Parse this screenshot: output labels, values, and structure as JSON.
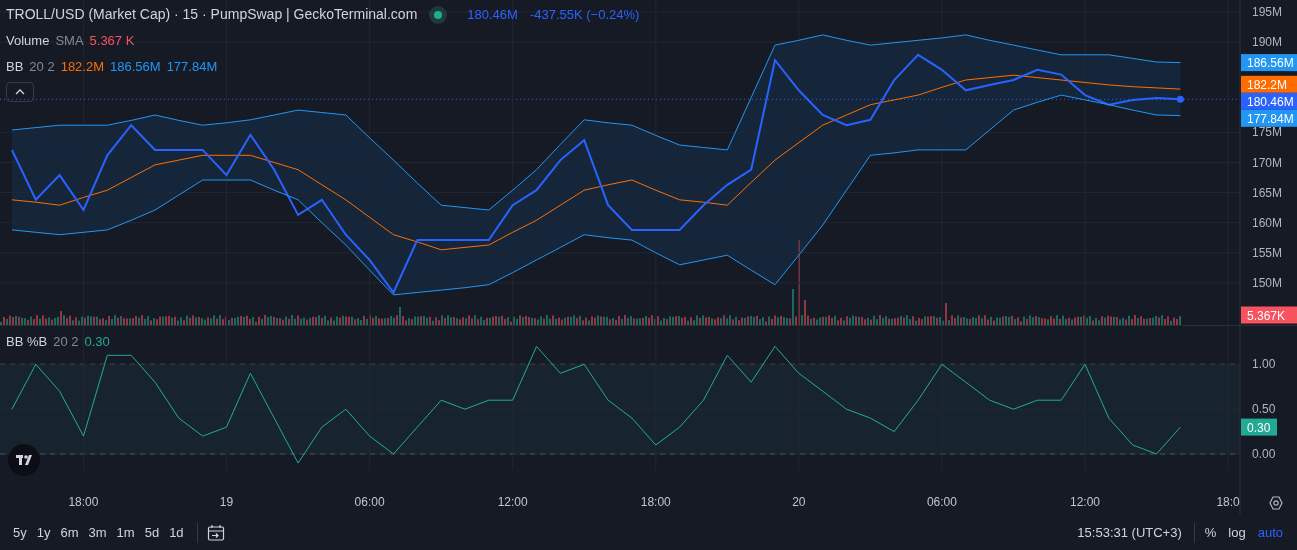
{
  "main_chart": {
    "title": "TROLL/USD (Market Cap) · 15 · PumpSwap | GeckoTerminal.com",
    "last": "180.46M",
    "change": "-437.55K (−0.24%)",
    "indicators": [
      {
        "name": "Volume",
        "params": "SMA",
        "values": [
          {
            "text": "5.367 K",
            "color": "#f7525f"
          }
        ]
      },
      {
        "name": "BB",
        "params": "20 2",
        "values": [
          {
            "text": "182.2M",
            "color": "#ff6d00"
          },
          {
            "text": "186.56M",
            "color": "#2196f3"
          },
          {
            "text": "177.84M",
            "color": "#2196f3"
          }
        ]
      }
    ],
    "price_labels": [
      {
        "kind": "series",
        "text": "186.56M",
        "color": "#2196f3"
      },
      {
        "kind": "series",
        "text": "182.2M",
        "color": "#ff6d00"
      },
      {
        "kind": "series",
        "text": "180.46M",
        "color": "#2962ff"
      },
      {
        "kind": "series",
        "text": "177.84M",
        "color": "#2196f3"
      },
      {
        "kind": "volume",
        "text": "5.367K",
        "color": "#f7525f"
      }
    ],
    "chart_data": {
      "type": "line",
      "grid": true,
      "categories": [
        null,
        null,
        null,
        null,
        null,
        null,
        null,
        null,
        null,
        null,
        null,
        null,
        null,
        null,
        null,
        null,
        null,
        null,
        null,
        null,
        null,
        null,
        null,
        null,
        null,
        null,
        null,
        null,
        null,
        null,
        null,
        null,
        null,
        null,
        null,
        null,
        null,
        null,
        null,
        null,
        null,
        null,
        null,
        null,
        null,
        null,
        null,
        null,
        null,
        null
      ],
      "ylim": [
        143,
        197
      ],
      "yticks": [
        {
          "value": 150,
          "label": "150M"
        },
        {
          "value": 155,
          "label": "155M"
        },
        {
          "value": 160,
          "label": "160M"
        },
        {
          "value": 165,
          "label": "165M"
        },
        {
          "value": 170,
          "label": "170M"
        },
        {
          "value": 175,
          "label": "175M"
        },
        {
          "value": 190,
          "label": "190M"
        },
        {
          "value": 195,
          "label": "195M"
        }
      ],
      "series": [
        {
          "color": "#2196f3",
          "values": [
            175.4,
            175.8,
            176.2,
            176.2,
            176.2,
            177.0,
            177.9,
            177.0,
            176.2,
            176.6,
            177.1,
            177.9,
            178.7,
            178.3,
            177.9,
            174.1,
            170.4,
            166.6,
            162.9,
            162.5,
            162.1,
            165.4,
            168.8,
            173.0,
            177.1,
            176.6,
            176.2,
            174.5,
            172.9,
            172.5,
            172.1,
            180.8,
            189.5,
            190.3,
            191.2,
            190.3,
            189.5,
            189.9,
            190.3,
            190.7,
            191.2,
            190.3,
            189.5,
            188.7,
            187.9,
            187.9,
            187.9,
            187.3,
            186.7,
            186.6
          ]
        },
        {
          "color": "#ff6d00",
          "values": [
            163.8,
            163.4,
            162.9,
            164.2,
            165.4,
            167.5,
            169.6,
            170.4,
            171.2,
            171.2,
            171.2,
            170.0,
            168.8,
            166.3,
            163.8,
            160.9,
            158.0,
            156.8,
            155.5,
            155.9,
            156.3,
            158.4,
            160.4,
            162.9,
            165.4,
            166.3,
            167.1,
            165.4,
            163.8,
            163.4,
            162.9,
            166.7,
            170.4,
            173.3,
            176.2,
            177.9,
            179.6,
            180.4,
            181.2,
            182.5,
            183.7,
            184.1,
            184.5,
            184.1,
            183.7,
            183.3,
            182.9,
            182.6,
            182.4,
            182.2
          ]
        },
        {
          "color": "#2962ff",
          "values": [
            172.1,
            163.8,
            167.9,
            162.1,
            171.2,
            176.2,
            172.1,
            172.1,
            172.1,
            167.9,
            174.6,
            168.8,
            161.3,
            163.8,
            158.0,
            153.8,
            148.4,
            157.1,
            157.1,
            157.1,
            157.1,
            162.9,
            165.4,
            170.4,
            173.7,
            162.9,
            158.8,
            158.8,
            158.8,
            162.9,
            166.3,
            168.8,
            187.0,
            182.0,
            177.9,
            176.2,
            177.1,
            183.7,
            187.9,
            185.4,
            182.0,
            182.9,
            183.7,
            185.4,
            184.6,
            181.2,
            179.6,
            180.4,
            180.7,
            180.5
          ]
        },
        {
          "color": "#2196f3",
          "values": [
            158.8,
            158.4,
            158.0,
            158.4,
            158.8,
            160.4,
            162.1,
            164.6,
            167.1,
            167.1,
            167.1,
            165.4,
            163.8,
            160.0,
            156.3,
            152.1,
            148.0,
            148.4,
            148.8,
            149.2,
            149.7,
            151.7,
            153.8,
            155.9,
            158.0,
            157.5,
            157.1,
            155.0,
            153.0,
            153.8,
            154.6,
            152.1,
            149.7,
            154.6,
            159.6,
            165.4,
            171.2,
            171.6,
            172.1,
            172.1,
            172.1,
            175.4,
            178.7,
            180.0,
            181.2,
            180.4,
            179.6,
            178.7,
            177.9,
            177.8
          ]
        }
      ]
    },
    "time_axis_end_label": "18:0"
  },
  "oscillator": {
    "name": "BB %B",
    "params": "20 2",
    "value": {
      "text": "0.30",
      "color": "#22ab94"
    },
    "price_label": {
      "text": "0.30",
      "color": "#22ab94"
    },
    "chart_data": {
      "type": "line",
      "grid": true,
      "ylim": [
        -0.68,
        1.427
      ],
      "yticks": [
        {
          "value": 0,
          "label": "0.00"
        },
        {
          "value": 0.5,
          "label": "0.50"
        },
        {
          "value": 1,
          "label": "1.00"
        }
      ],
      "categories": [
        null,
        null,
        null,
        "18:00",
        null,
        null,
        null,
        null,
        null,
        "19",
        null,
        null,
        null,
        null,
        null,
        "06:00",
        null,
        null,
        null,
        null,
        null,
        "12:00",
        null,
        null,
        null,
        null,
        null,
        "18:00",
        null,
        null,
        null,
        null,
        null,
        "20",
        null,
        null,
        null,
        null,
        null,
        "06:00",
        null,
        null,
        null,
        null,
        null,
        "12:00",
        null,
        null,
        null,
        null
      ],
      "series": [
        {
          "color": "#22ab94",
          "values": [
            0.5,
            1.0,
            0.7,
            0.2,
            1.1,
            1.1,
            0.8,
            0.4,
            0.2,
            0.3,
            0.9,
            0.4,
            -0.1,
            0.3,
            0.5,
            0.2,
            0.0,
            0.3,
            0.6,
            0.5,
            0.6,
            0.6,
            1.2,
            0.9,
            1.0,
            0.6,
            0.4,
            0.1,
            0.3,
            0.6,
            1.1,
            0.8,
            1.2,
            0.9,
            0.7,
            0.5,
            0.4,
            0.25,
            0.6,
            1.0,
            0.8,
            0.6,
            0.5,
            0.6,
            0.6,
            1.0,
            0.4,
            0.1,
            0.0,
            0.3
          ]
        }
      ]
    }
  },
  "toolbar": {
    "ranges": [
      "5y",
      "1y",
      "6m",
      "3m",
      "1m",
      "5d",
      "1d"
    ],
    "time": "15:53:31 (UTC+3)",
    "scale_buttons": [
      {
        "label": "%",
        "selected": false
      },
      {
        "label": "log",
        "selected": false
      },
      {
        "label": "auto",
        "selected": true
      }
    ]
  }
}
